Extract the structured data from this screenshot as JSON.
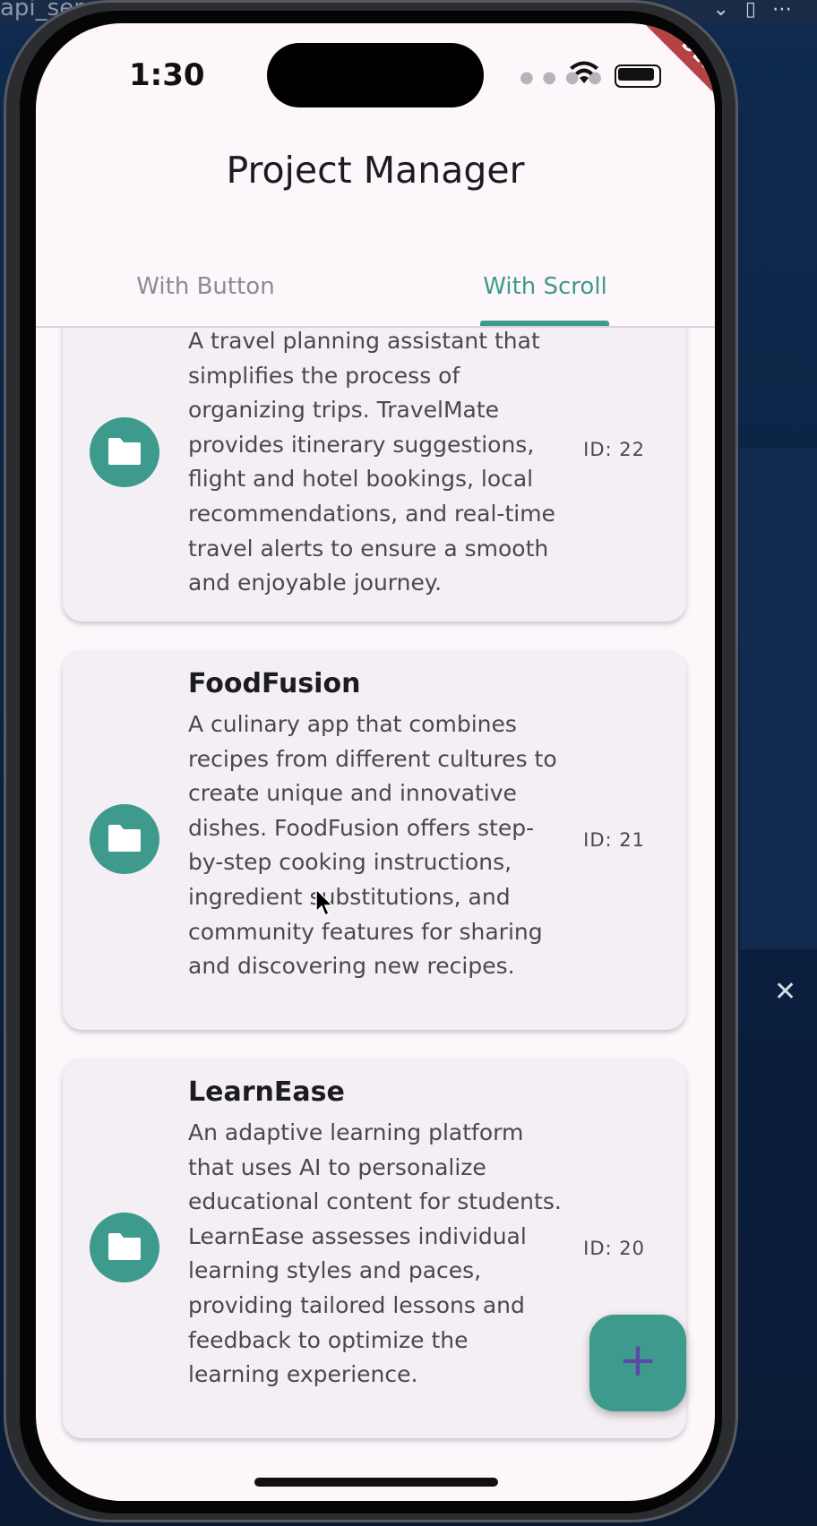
{
  "ide": {
    "filename": "api_ser",
    "close_glyph": "✕"
  },
  "status_bar": {
    "time": "1:30",
    "debug_banner": "DEBUG"
  },
  "app": {
    "title": "Project Manager",
    "tabs": [
      {
        "label": "With Button",
        "selected": false
      },
      {
        "label": "With Scroll",
        "selected": true
      }
    ]
  },
  "projects": [
    {
      "title": "",
      "description": "A travel planning assistant that simplifies the process of organizing trips. TravelMate provides itinerary suggestions, flight and hotel bookings, local recommendations, and real-time travel alerts to ensure a smooth and enjoyable journey.",
      "id_label": "ID: 22",
      "icon": "folder-icon"
    },
    {
      "title": "FoodFusion",
      "description": "A culinary app that combines recipes from different cultures to create unique and innovative dishes. FoodFusion offers step-by-step cooking instructions, ingredient substitutions, and community features for sharing and discovering new recipes.",
      "id_label": "ID: 21",
      "icon": "folder-icon"
    },
    {
      "title": "LearnEase",
      "description": "An adaptive learning platform that uses AI to personalize educational content for students. LearnEase assesses individual learning styles and paces, providing tailored lessons and feedback to optimize the learning experience.",
      "id_label": "ID: 20",
      "icon": "folder-icon"
    }
  ],
  "fab": {
    "label": "+"
  },
  "colors": {
    "accent": "#3d9a8c",
    "fab_icon": "#5b4aa5",
    "surface": "#fdf6fb",
    "card": "#f4eff4",
    "debug_banner": "#b44444"
  }
}
